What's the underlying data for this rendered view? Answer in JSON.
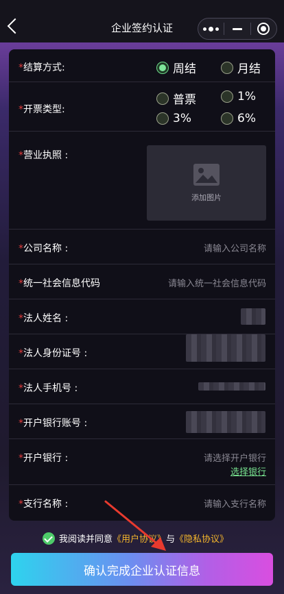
{
  "nav": {
    "title": "企业签约认证"
  },
  "form": {
    "settlement": {
      "label": "结算方式:",
      "options": [
        "周结",
        "月结"
      ],
      "selected": "周结"
    },
    "invoice": {
      "label": "开票类型:",
      "options": [
        "普票",
        "1%",
        "3%",
        "6%"
      ]
    },
    "license": {
      "label": "营业执照 :",
      "upload_text": "添加图片"
    },
    "company_name": {
      "label": "公司名称 :",
      "placeholder": "请输入公司名称"
    },
    "credit_code": {
      "label": "统一社会信息代码",
      "placeholder": "请输入统一社会信息代码"
    },
    "legal_name": {
      "label": "法人姓名 :"
    },
    "legal_id": {
      "label": "法人身份证号 :"
    },
    "legal_phone": {
      "label": "法人手机号 :"
    },
    "bank_account": {
      "label": "开户银行账号 :"
    },
    "bank": {
      "label": "开户银行 :",
      "placeholder": "请选择开户银行",
      "link": "选择银行"
    },
    "branch": {
      "label": "支行名称 :",
      "placeholder": "请输入支行名称"
    }
  },
  "agreement": {
    "prefix": "我阅读并同意",
    "user_link": "《用户协议》",
    "and": "与",
    "privacy_link": "《隐私协议》",
    "checked": true
  },
  "submit_label": "确认完成企业认证信息",
  "colors": {
    "accent_green": "#77e28f",
    "required_star": "#e23b3b",
    "agreement_link": "#f5b62c"
  }
}
